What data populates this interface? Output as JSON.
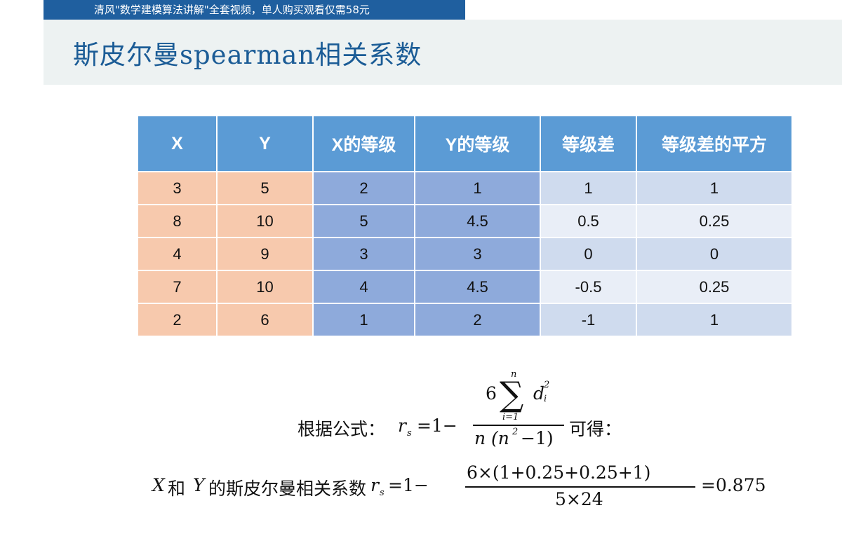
{
  "banner": {
    "text": "清风\"数学建模算法讲解\"全套视频，单人购买观看仅需58元"
  },
  "slide": {
    "title": "斯皮尔曼spearman相关系数"
  },
  "table": {
    "headers": [
      "X",
      "Y",
      "X的等级",
      "Y的等级",
      "等级差",
      "等级差的平方"
    ],
    "rows": [
      [
        "3",
        "5",
        "2",
        "1",
        "1",
        "1"
      ],
      [
        "8",
        "10",
        "5",
        "4.5",
        "0.5",
        "0.25"
      ],
      [
        "4",
        "9",
        "3",
        "3",
        "0",
        "0"
      ],
      [
        "7",
        "10",
        "4",
        "4.5",
        "-0.5",
        "0.25"
      ],
      [
        "2",
        "6",
        "1",
        "2",
        "-1",
        "1"
      ]
    ]
  },
  "formula1": {
    "prefix": "根据公式：",
    "lhs": "r",
    "lhs_sub": "s",
    "eq": "=1−",
    "num_coef": "6",
    "sigma": "∑",
    "sum_upper": "n",
    "sum_lower": "i=1",
    "summand": "d",
    "summand_sup": "2",
    "summand_sub": "i",
    "den_pre": "n (n",
    "den_sup": "2",
    "den_post": "−1)",
    "suffix": "可得："
  },
  "formula2": {
    "var_x": "X",
    "mid": "和",
    "var_y": "Y",
    "text": "的斯皮尔曼相关系数",
    "lhs": "r",
    "lhs_sub": "s",
    "eq": "=1−",
    "numerator": "6×(1+0.25+0.25+1)",
    "denominator": "5×24",
    "result": "=0.875"
  }
}
